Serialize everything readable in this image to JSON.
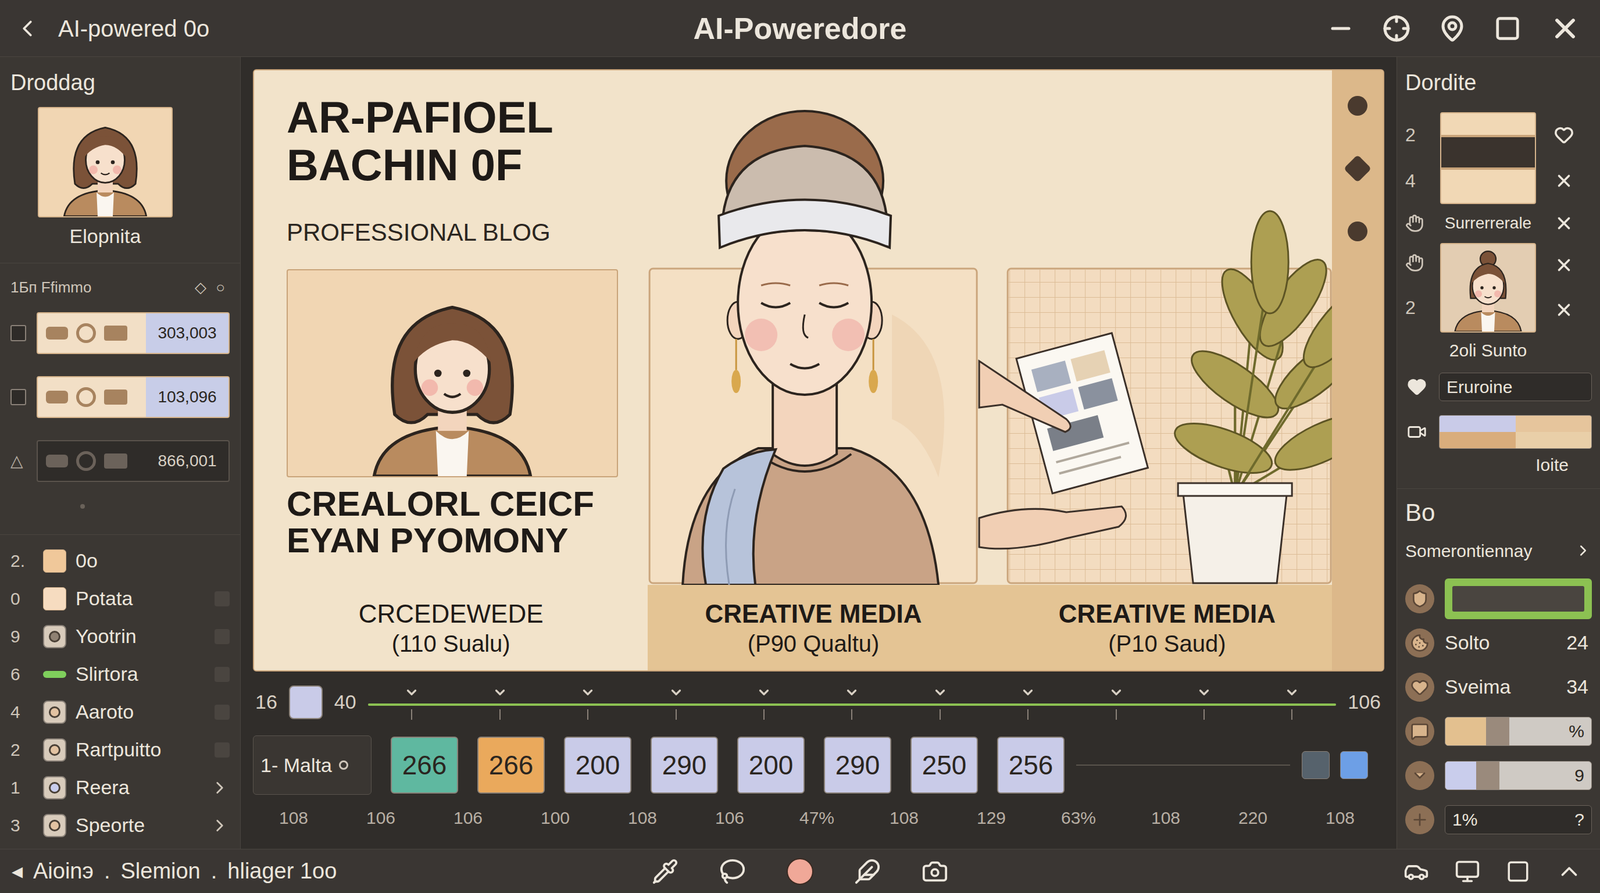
{
  "window": {
    "back_label": "AI-powered 0o",
    "title": "AI-Poweredore"
  },
  "left_panel": {
    "heading": "Droddag",
    "profile_name": "Elopnita",
    "assets_header": "1Бп Ffimmo",
    "header_marks": [
      "◇",
      "○"
    ],
    "assets": [
      {
        "kind": "checkbox",
        "checked": false,
        "value": "303,003",
        "selected": false
      },
      {
        "kind": "checkbox",
        "checked": false,
        "value": "103,096",
        "selected": false
      },
      {
        "kind": "glyph",
        "marker": "△",
        "value": "866,001",
        "selected": true
      }
    ],
    "layers": [
      {
        "index": "2.",
        "label": "0o",
        "kind": "swatch",
        "color": "#f0c89a",
        "trailing": "none"
      },
      {
        "index": "0",
        "label": "Potata",
        "kind": "swatch",
        "color": "#f6dcc0",
        "trailing": "box"
      },
      {
        "index": "9",
        "label": "Yootrin",
        "kind": "icon",
        "color": "#8f8172",
        "trailing": "box"
      },
      {
        "index": "6",
        "label": "Slirtora",
        "kind": "bar",
        "color": "#7fcf5c",
        "trailing": "box"
      },
      {
        "index": "4",
        "label": "Aaroto",
        "kind": "icon",
        "color": "#e3c3a2",
        "trailing": "box"
      },
      {
        "index": "2",
        "label": "Rartpuitto",
        "kind": "icon",
        "color": "#e3c3a2",
        "trailing": "box"
      },
      {
        "index": "1",
        "label": "Reera",
        "kind": "icon",
        "color": "#c9cdec",
        "trailing": "chevron"
      },
      {
        "index": "3",
        "label": "Speorte",
        "kind": "icon",
        "color": "#e3c3a2",
        "trailing": "chevron"
      }
    ]
  },
  "canvas": {
    "title_lines": [
      "AR-PAFIOEL",
      "BACHIN 0F"
    ],
    "subtitle": "PROFESSIONAL BLOG",
    "headline_lines": [
      "CREALORL CEICF",
      "EYAN PYOMONY"
    ],
    "captions": [
      {
        "title": "CRCEDEWEDE",
        "detail": "(110 Sualu)"
      },
      {
        "title": "CREATIVE MEDIA",
        "detail": "(P90 Qualtu)"
      },
      {
        "title": "CREATIVE MEDIA",
        "detail": "(P10 Saud)"
      }
    ]
  },
  "timeline": {
    "start": "16",
    "marker": "40",
    "end": "106",
    "level": 1,
    "swatch_color": "#c9cbe8"
  },
  "clips": {
    "track_label": "1- Malta",
    "items": [
      {
        "label": "266",
        "color": "#5fb8a0"
      },
      {
        "label": "266",
        "color": "#eaa95c"
      },
      {
        "label": "200",
        "color": "#c9cbe8"
      },
      {
        "label": "290",
        "color": "#c9cbe8"
      },
      {
        "label": "200",
        "color": "#c9cbe8"
      },
      {
        "label": "290",
        "color": "#c9cbe8"
      },
      {
        "label": "250",
        "color": "#c9cbe8"
      },
      {
        "label": "256",
        "color": "#c9cbe8"
      }
    ],
    "end_swatches": [
      {
        "color": "#56626c"
      },
      {
        "color": "#6d9fe6"
      }
    ]
  },
  "ruler": [
    "108",
    "106",
    "106",
    "100",
    "108",
    "106",
    "47%",
    "108",
    "129",
    "63%",
    "108",
    "220",
    "108"
  ],
  "right_panel": {
    "heading": "Dordite",
    "markers": [
      "2",
      "4",
      "2"
    ],
    "thumb_labels": [
      "Surrerrerale",
      "2oli Sunto"
    ],
    "field": "Eruroine",
    "swatch_colors": [
      "#c9cbe8",
      "#e6c59c",
      "#d9ad7c",
      "#e9cfa8"
    ],
    "swatch_label": "Ioite"
  },
  "properties": {
    "heading": "Bo",
    "subheading": "Somerontiennay",
    "rows": [
      {
        "kind": "swatch",
        "selected": true
      },
      {
        "kind": "label",
        "label": "Solto",
        "value": "24",
        "selected": false
      },
      {
        "kind": "label",
        "label": "Sveima",
        "value": "34",
        "selected": false
      },
      {
        "kind": "slider",
        "level": 0.35,
        "color": "#e3c08f",
        "value": "%",
        "selected": false
      },
      {
        "kind": "slider",
        "level": 0.25,
        "color": "#c9cdec",
        "value": "9",
        "selected": false
      },
      {
        "kind": "input",
        "text": "1%",
        "value": "?",
        "selected": false
      }
    ]
  },
  "status_bar": {
    "lead": "◂",
    "separator": ".",
    "crumbs": [
      "Aioinэ",
      "Slemion",
      "hliager 1oo"
    ]
  }
}
